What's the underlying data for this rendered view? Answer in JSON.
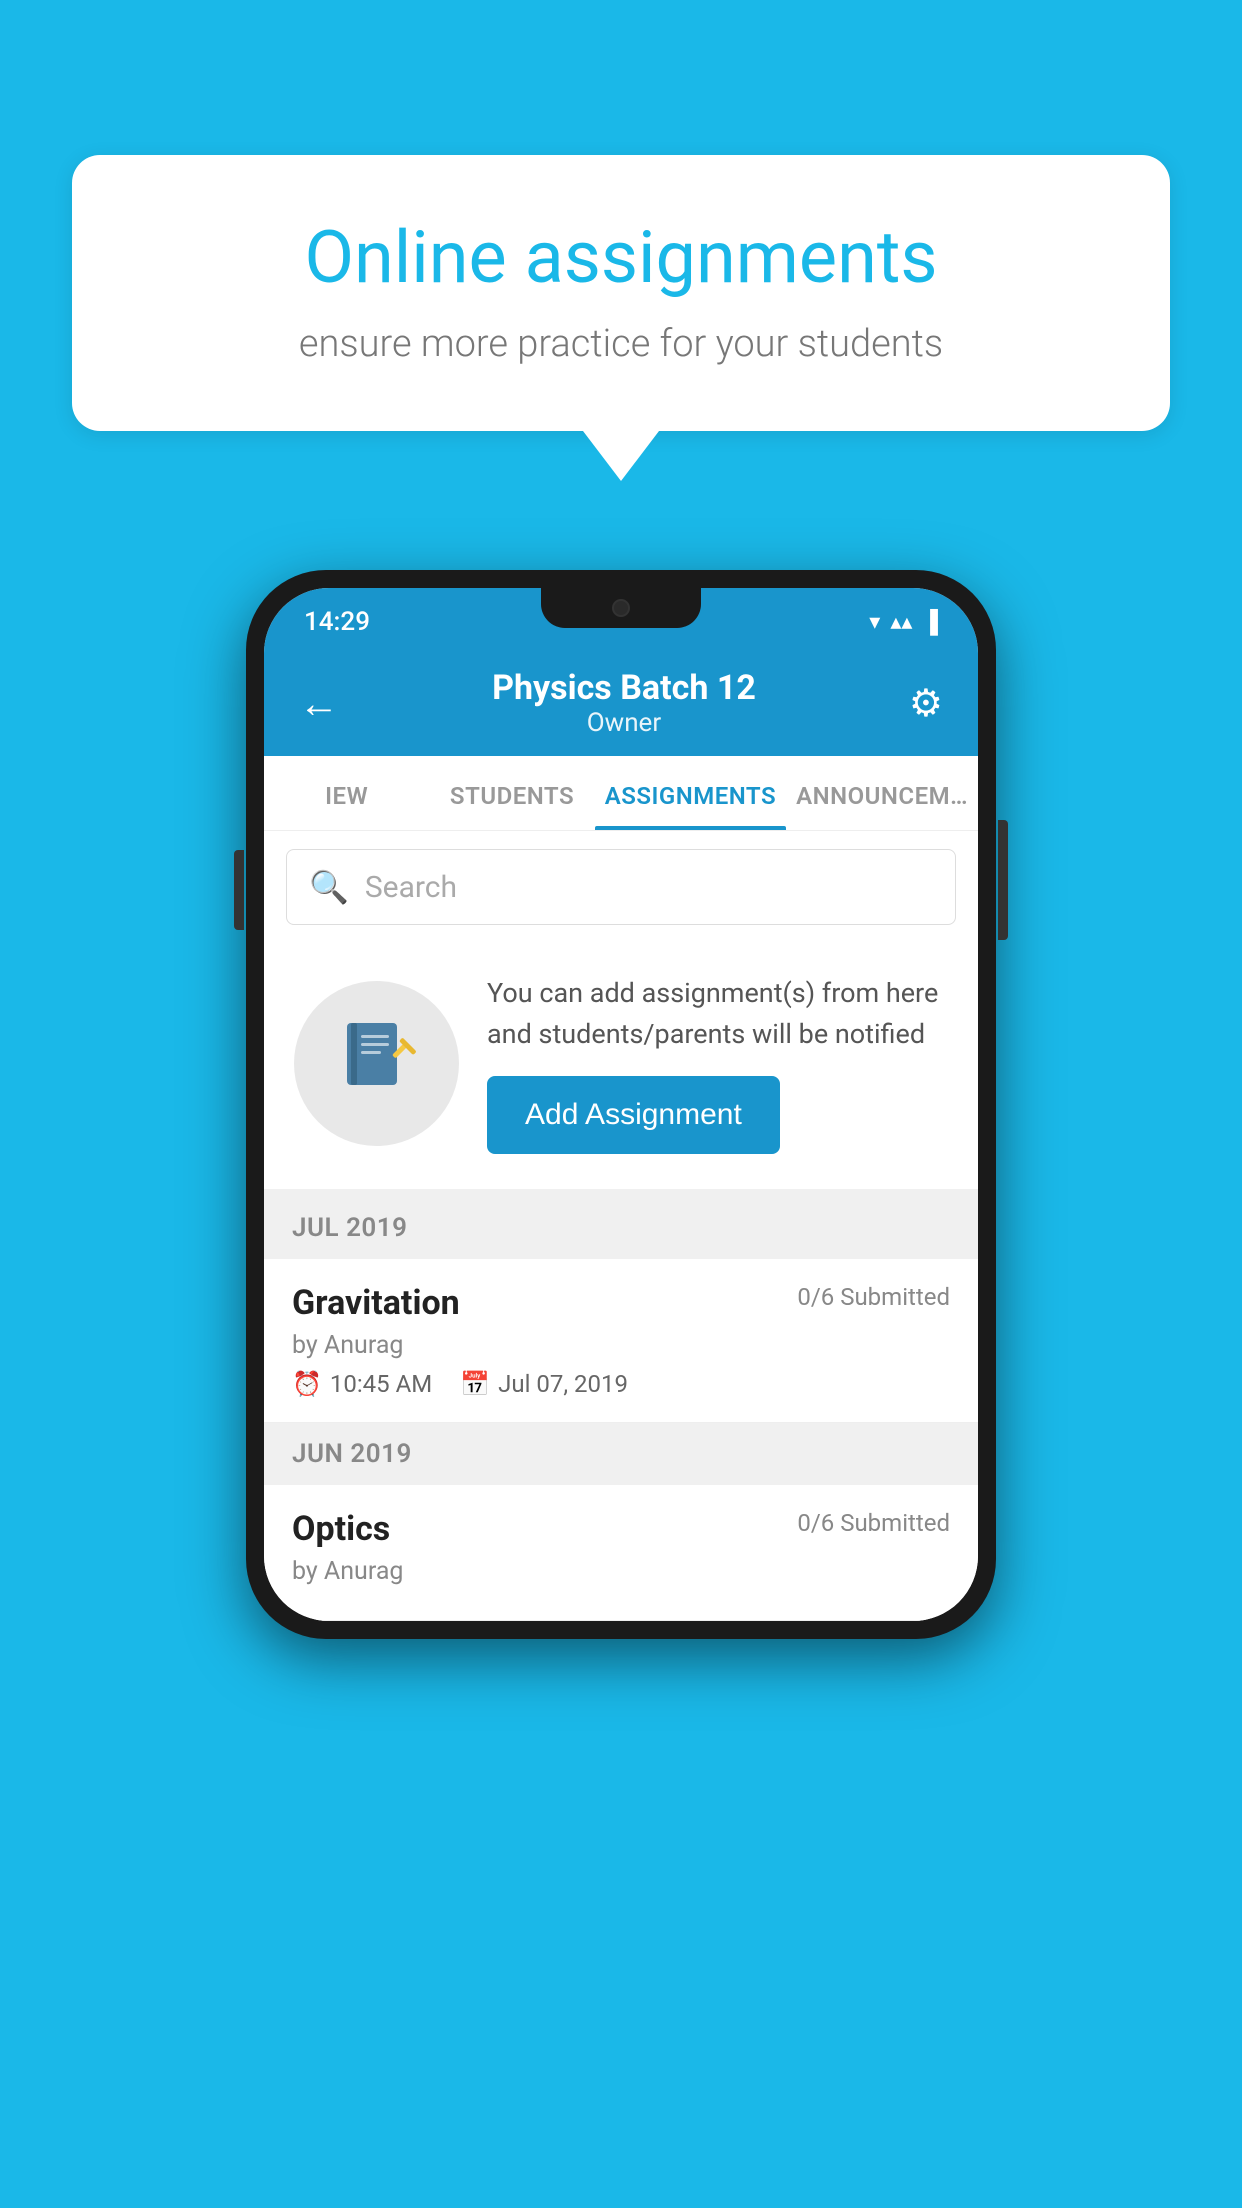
{
  "background_color": "#1ab8e8",
  "speech_bubble": {
    "title": "Online assignments",
    "subtitle": "ensure more practice for your students"
  },
  "status_bar": {
    "time": "14:29",
    "wifi_icon": "▼",
    "signal_icon": "▲",
    "battery_icon": "▌"
  },
  "app_bar": {
    "back_icon": "←",
    "title": "Physics Batch 12",
    "subtitle": "Owner",
    "settings_icon": "⚙"
  },
  "tabs": [
    {
      "label": "IEW",
      "active": false
    },
    {
      "label": "STUDENTS",
      "active": false
    },
    {
      "label": "ASSIGNMENTS",
      "active": true
    },
    {
      "label": "ANNOUNCEM...",
      "active": false
    }
  ],
  "search": {
    "placeholder": "Search",
    "icon": "🔍"
  },
  "promo": {
    "icon": "📓",
    "text": "You can add assignment(s) from here and students/parents will be notified",
    "button_label": "Add Assignment"
  },
  "sections": [
    {
      "header": "JUL 2019",
      "items": [
        {
          "title": "Gravitation",
          "submitted": "0/6 Submitted",
          "by": "by Anurag",
          "time": "10:45 AM",
          "date": "Jul 07, 2019"
        }
      ]
    },
    {
      "header": "JUN 2019",
      "items": [
        {
          "title": "Optics",
          "submitted": "0/6 Submitted",
          "by": "by Anurag",
          "time": "",
          "date": ""
        }
      ]
    }
  ]
}
